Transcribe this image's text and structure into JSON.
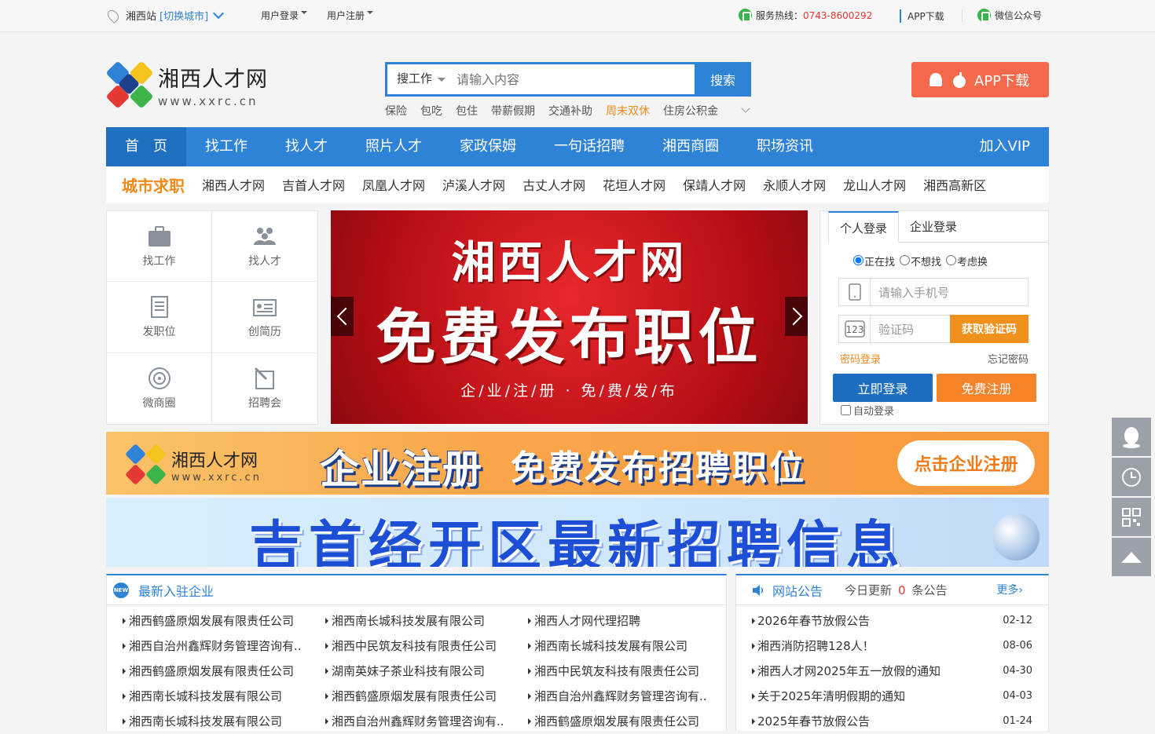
{
  "topbar": {
    "station": "湘西站",
    "switch_city": "[切换城市]",
    "login": "用户登录",
    "register": "用户注册",
    "hotline_label": "服务热线：",
    "hotline_number": "0743-8600292",
    "app_download": "APP下载",
    "wechat": "微信公众号"
  },
  "logo": {
    "cn": "湘西人才网",
    "en": "www.xxrc.cn"
  },
  "search": {
    "type": "搜工作",
    "placeholder": "请输入内容",
    "button": "搜索",
    "hotwords": [
      "保险",
      "包吃",
      "包住",
      "带薪假期",
      "交通补助",
      "周末双休",
      "住房公积金"
    ],
    "highlight_index": 5
  },
  "app_button": "APP下载",
  "nav": [
    "首　页",
    "找工作",
    "找人才",
    "照片人才",
    "家政保姆",
    "一句话招聘",
    "湘西商圈",
    "职场资讯",
    "加入VIP"
  ],
  "cities": {
    "title": "城市求职",
    "items": [
      "湘西人才网",
      "吉首人才网",
      "凤凰人才网",
      "泸溪人才网",
      "古丈人才网",
      "花垣人才网",
      "保靖人才网",
      "永顺人才网",
      "龙山人才网",
      "湘西高新区"
    ]
  },
  "quick": [
    "找工作",
    "找人才",
    "发职位",
    "创简历",
    "微商圈",
    "招聘会"
  ],
  "banner": {
    "line1": "湘西人才网",
    "line2": "免费发布职位",
    "line3": "企/业/注/册 · 免/费/发/布"
  },
  "login": {
    "tab_personal": "个人登录",
    "tab_company": "企业登录",
    "status": [
      "正在找",
      "不想找",
      "考虑换"
    ],
    "phone_placeholder": "请输入手机号",
    "code_placeholder": "验证码",
    "get_code": "获取验证码",
    "password_login": "密码登录",
    "forgot": "忘记密码",
    "login_btn": "立即登录",
    "register_btn": "免费注册",
    "auto_login": "自动登录"
  },
  "ad1": {
    "logo_cn": "湘西人才网",
    "logo_en": "www.xxrc.cn",
    "text1": "企业注册",
    "text2": "免费发布招聘职位",
    "cta": "点击企业注册"
  },
  "ad2": {
    "text": "吉首经开区最新招聘信息"
  },
  "enterprises": {
    "icon_text": "NEW",
    "title": "最新入驻企业",
    "items": [
      "湘西鹤盛原烟发展有限责任公司",
      "湘西南长城科技发展有限公司",
      "湘西人才网代理招聘",
      "湘西自治州鑫辉财务管理咨询有..",
      "湘西中民筑友科技有限责任公司",
      "湘西南长城科技发展有限公司",
      "湘西鹤盛原烟发展有限责任公司",
      "湖南英妹子茶业科技有限公司",
      "湘西中民筑友科技有限责任公司",
      "湘西南长城科技发展有限公司",
      "湘西鹤盛原烟发展有限责任公司",
      "湘西自治州鑫辉财务管理咨询有..",
      "湘西南长城科技发展有限公司",
      "湘西自治州鑫辉财务管理咨询有..",
      "湘西鹤盛原烟发展有限责任公司"
    ]
  },
  "notice": {
    "title": "网站公告",
    "today_label": "今日更新",
    "today_count": "0",
    "unit": "条公告",
    "more": "更多›",
    "items": [
      {
        "title": "2026年春节放假公告",
        "date": "02-12"
      },
      {
        "title": "湘西消防招聘128人！",
        "date": "08-06"
      },
      {
        "title": "湘西人才网2025年五一放假的通知",
        "date": "04-30"
      },
      {
        "title": "关于2025年清明假期的通知",
        "date": "04-03"
      },
      {
        "title": "2025年春节放假公告",
        "date": "01-24"
      }
    ]
  },
  "colors": {
    "primary": "#2f83d6",
    "orange": "#f08a1d",
    "red": "#e53935"
  }
}
